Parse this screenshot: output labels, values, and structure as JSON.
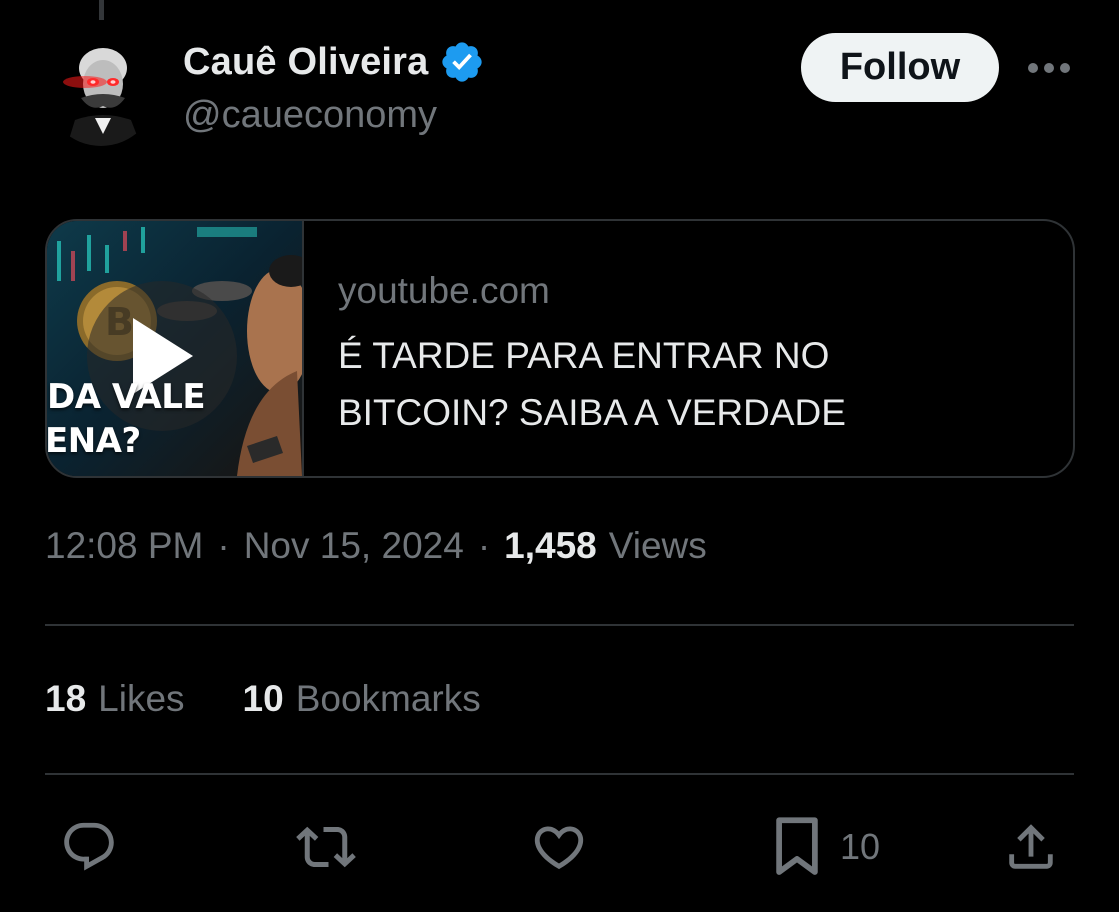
{
  "tweet": {
    "author": {
      "display_name": "Cauê Oliveira",
      "handle": "@caueconomy",
      "verified": true
    },
    "follow_label": "Follow",
    "card": {
      "domain": "youtube.com",
      "title": "É TARDE PARA ENTRAR NO BITCOIN? SAIBA A VERDADE",
      "thumbnail_text_line1": "DA VALE",
      "thumbnail_text_line2": "ENA?"
    },
    "meta": {
      "time": "12:08 PM",
      "separator": "·",
      "date": "Nov 15, 2024",
      "views_count": "1,458",
      "views_label": "Views"
    },
    "stats": {
      "likes_count": "18",
      "likes_label": "Likes",
      "bookmarks_count": "10",
      "bookmarks_label": "Bookmarks"
    },
    "actions": {
      "bookmark_count": "10"
    }
  },
  "colors": {
    "background": "#000000",
    "text_primary": "#e7e9ea",
    "text_secondary": "#71767b",
    "border": "#2f3336",
    "verified_blue": "#1d9bf0",
    "follow_bg": "#eff3f4"
  },
  "icons": [
    "verified-badge-icon",
    "more-dots-icon",
    "play-icon",
    "reply-icon",
    "retweet-icon",
    "like-icon",
    "bookmark-icon",
    "share-icon"
  ]
}
